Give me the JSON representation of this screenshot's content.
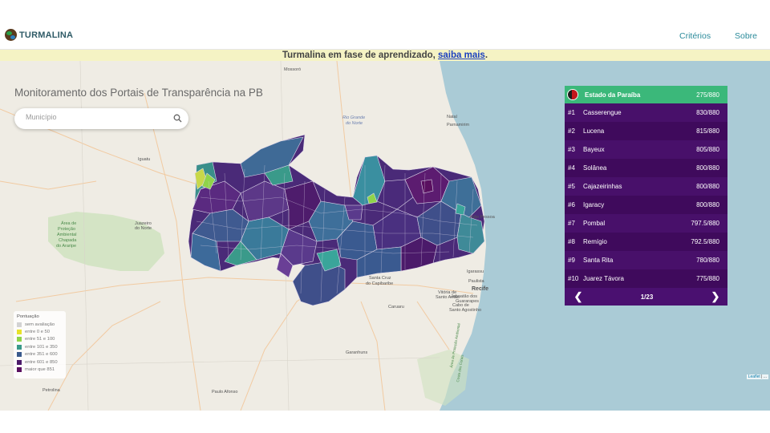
{
  "navbar": {
    "brand": "TURMALINA",
    "links": [
      "Critérios",
      "Sobre"
    ]
  },
  "notice": {
    "text": "Turmalina em fase de aprendizado, ",
    "link": "saiba mais",
    "suffix": "."
  },
  "map": {
    "title": "Monitoramento dos Portais de Transparência na PB",
    "search_placeholder": "Município",
    "labels": {
      "mossoro": "Mossoró",
      "rio_grande": "Rio Grande",
      "do_norte": "do Norte",
      "natal": "Natal",
      "parnamirim": "Parnamirim",
      "iguatu": "Iguatu",
      "area": "Área de",
      "protecao": "Proteção",
      "ambiental": "Ambiental",
      "chapada": "Chapada",
      "araripe": "do Araripe",
      "juazeiro": "Juazeiro",
      "do_norte2": "do Norte",
      "joao_pessoa": "João Pessoa",
      "santa_cruz": "Santa Cruz",
      "capibaribe": "do Capibaribe",
      "igarassu": "Igarassu",
      "paulista": "Paulista",
      "recife": "Recife",
      "vitoria": "Vitória de",
      "santo_antao": "Santo Antão",
      "jaboatao": "Jaboatão dos",
      "guararapes": "Guararapes",
      "cabo": "Cabo de",
      "santo_agostinho": "Santo Agostinho",
      "caruaru": "Caruaru",
      "garanhuns": "Garanhuns",
      "paulo_afonso": "Paulo Afonso",
      "petrolina": "Petrolina",
      "apa": "Área de Proteção Ambiental",
      "costa": "Costa dos Corais"
    },
    "attribution_link": "Leaflet",
    "attribution_sep": " | ..."
  },
  "ranking": {
    "state": {
      "name": "Estado da Paraíba",
      "score": "275/880"
    },
    "rows": [
      {
        "pos": "#1",
        "name": "Casserengue",
        "score": "830/880"
      },
      {
        "pos": "#2",
        "name": "Lucena",
        "score": "815/880"
      },
      {
        "pos": "#3",
        "name": "Bayeux",
        "score": "805/880"
      },
      {
        "pos": "#4",
        "name": "Solânea",
        "score": "800/880"
      },
      {
        "pos": "#5",
        "name": "Cajazeirinhas",
        "score": "800/880"
      },
      {
        "pos": "#6",
        "name": "Igaracy",
        "score": "800/880"
      },
      {
        "pos": "#7",
        "name": "Pombal",
        "score": "797.5/880"
      },
      {
        "pos": "#8",
        "name": "Remígio",
        "score": "792.5/880"
      },
      {
        "pos": "#9",
        "name": "Santa Rita",
        "score": "780/880"
      },
      {
        "pos": "#10",
        "name": "Juarez Távora",
        "score": "775/880"
      }
    ],
    "page_label": "1/23",
    "prev_icon": "chevron-left-icon",
    "next_icon": "chevron-right-icon"
  },
  "legend": {
    "title": "Pontuação",
    "items": [
      {
        "label": "sem avaliação",
        "color": "#d3d3d3"
      },
      {
        "label": "entre 0 e 50",
        "color": "#e8e22a"
      },
      {
        "label": "entre 51 e 100",
        "color": "#8fd44a"
      },
      {
        "label": "entre 101 e 350",
        "color": "#3a9a8a"
      },
      {
        "label": "entre 351 e 600",
        "color": "#3a5a8c"
      },
      {
        "label": "entre 601 e 850",
        "color": "#4b1a6a"
      },
      {
        "label": "maior que 851",
        "color": "#5a1060"
      }
    ]
  },
  "colors": {
    "ocean": "#aacbd6",
    "land": "#efece4",
    "ranking_bg": "#3f0a5c",
    "ranking_head": "#3bb87a",
    "accent": "#2a8a9a"
  }
}
